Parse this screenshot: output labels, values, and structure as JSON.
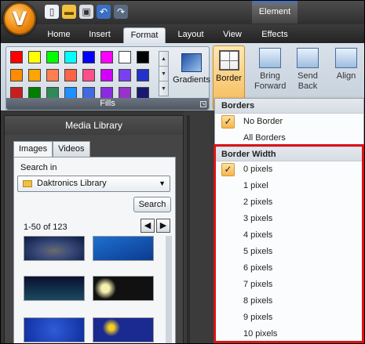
{
  "app": {
    "logo_letter": "V",
    "context_group": "Element"
  },
  "tabs": [
    {
      "label": "Home"
    },
    {
      "label": "Insert"
    },
    {
      "label": "Format",
      "active": true
    },
    {
      "label": "Layout"
    },
    {
      "label": "View"
    },
    {
      "label": "Effects"
    }
  ],
  "ribbon": {
    "fills_label": "Fills",
    "gradients_label": "Gradients",
    "border_label": "Border",
    "bring_forward_label": "Bring\nForward",
    "send_back_label": "Send\nBack",
    "align_label": "Align",
    "swatch_colors": [
      "#ff0000",
      "#ffff00",
      "#00ff00",
      "#00ffff",
      "#0000ff",
      "#ff00ff",
      "#ffffff",
      "#000000",
      "#ff8c00",
      "#ffa500",
      "#ff7f50",
      "#ff6347",
      "#ff4f8b",
      "#d400ff",
      "#7b3ff2",
      "#2233cc",
      "#c81e1e",
      "#008000",
      "#2e8b57",
      "#1e90ff",
      "#4169e1",
      "#8a2be2",
      "#9932cc",
      "#191970"
    ]
  },
  "media": {
    "title": "Media Library",
    "tab_images": "Images",
    "tab_videos": "Videos",
    "search_in_label": "Search in",
    "library_value": "Daktronics Library",
    "search_button": "Search",
    "result_count": "1-50 of 123"
  },
  "menu": {
    "borders_header": "Borders",
    "border_options": [
      {
        "label": "No Border",
        "checked": true
      },
      {
        "label": "All Borders",
        "checked": false
      }
    ],
    "width_header": "Border Width",
    "width_options": [
      {
        "label": "0 pixels",
        "checked": true
      },
      {
        "label": "1 pixel"
      },
      {
        "label": "2 pixels"
      },
      {
        "label": "3 pixels"
      },
      {
        "label": "4 pixels"
      },
      {
        "label": "5 pixels"
      },
      {
        "label": "6 pixels"
      },
      {
        "label": "7 pixels"
      },
      {
        "label": "8 pixels"
      },
      {
        "label": "9 pixels"
      },
      {
        "label": "10 pixels"
      }
    ]
  }
}
